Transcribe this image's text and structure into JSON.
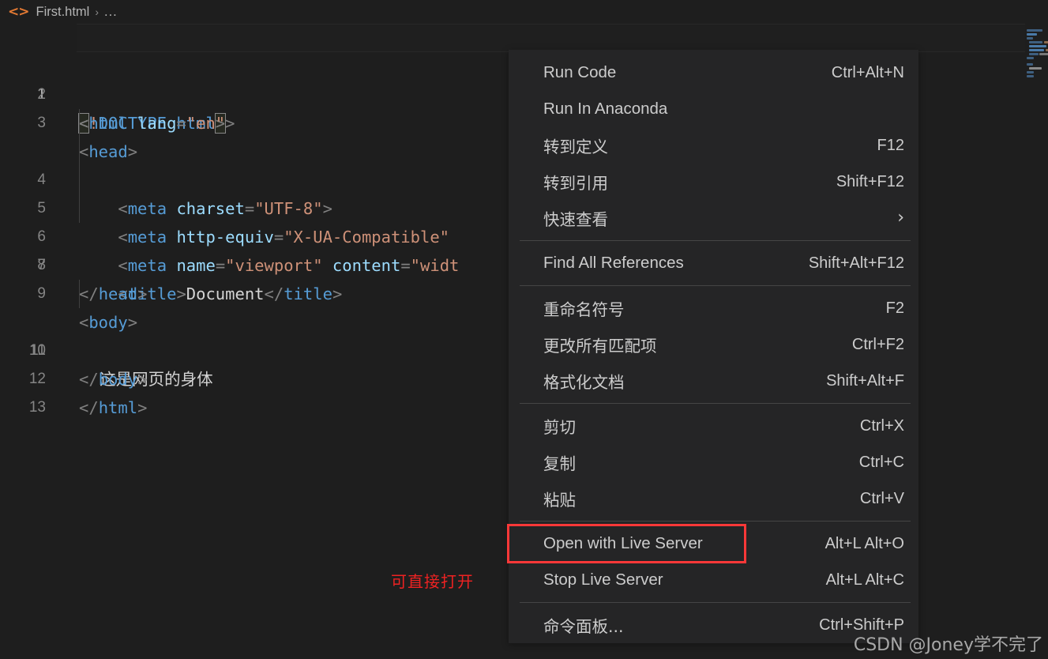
{
  "breadcrumb": {
    "icon": "html-file-icon",
    "file": "First.html",
    "separator": "›",
    "overflow": "..."
  },
  "editor": {
    "language": "html",
    "active_line": 1,
    "lines": [
      {
        "number": "1",
        "text": "<!DOCTYPE html>"
      },
      {
        "number": "2",
        "text": "<html lang=\"en\">"
      },
      {
        "number": "3",
        "text": "<head>"
      },
      {
        "number": "4",
        "text": "    <meta charset=\"UTF-8\">"
      },
      {
        "number": "5",
        "text": "    <meta http-equiv=\"X-UA-Compatible\""
      },
      {
        "number": "6",
        "text": "    <meta name=\"viewport\" content=\"widt"
      },
      {
        "number": "7",
        "text": "    <title>Document</title>"
      },
      {
        "number": "8",
        "text": "</head>"
      },
      {
        "number": "9",
        "text": "<body>"
      },
      {
        "number": "10",
        "text": "    这是网页的身体"
      },
      {
        "number": "11",
        "text": "</body>"
      },
      {
        "number": "12",
        "text": "</html>"
      },
      {
        "number": "13",
        "text": ""
      }
    ]
  },
  "annotation": {
    "text": "可直接打开",
    "color": "#ee2222"
  },
  "context_menu": {
    "groups": [
      {
        "items": [
          {
            "label": "Run Code",
            "key": "Ctrl+Alt+N",
            "cjk": false,
            "submenu": false,
            "highlighted": false
          },
          {
            "label": "Run In Anaconda",
            "key": "",
            "cjk": false,
            "submenu": false,
            "highlighted": false
          },
          {
            "label": "转到定义",
            "key": "F12",
            "cjk": true,
            "submenu": false,
            "highlighted": false
          },
          {
            "label": "转到引用",
            "key": "Shift+F12",
            "cjk": true,
            "submenu": false,
            "highlighted": false
          },
          {
            "label": "快速查看",
            "key": "",
            "cjk": true,
            "submenu": true,
            "highlighted": false
          }
        ]
      },
      {
        "items": [
          {
            "label": "Find All References",
            "key": "Shift+Alt+F12",
            "cjk": false,
            "submenu": false,
            "highlighted": false
          }
        ]
      },
      {
        "items": [
          {
            "label": "重命名符号",
            "key": "F2",
            "cjk": true,
            "submenu": false,
            "highlighted": false
          },
          {
            "label": "更改所有匹配项",
            "key": "Ctrl+F2",
            "cjk": true,
            "submenu": false,
            "highlighted": false
          },
          {
            "label": "格式化文档",
            "key": "Shift+Alt+F",
            "cjk": true,
            "submenu": false,
            "highlighted": false
          }
        ]
      },
      {
        "items": [
          {
            "label": "剪切",
            "key": "Ctrl+X",
            "cjk": true,
            "submenu": false,
            "highlighted": false
          },
          {
            "label": "复制",
            "key": "Ctrl+C",
            "cjk": true,
            "submenu": false,
            "highlighted": false
          },
          {
            "label": "粘贴",
            "key": "Ctrl+V",
            "cjk": true,
            "submenu": false,
            "highlighted": false
          }
        ]
      },
      {
        "items": [
          {
            "label": "Open with Live Server",
            "key": "Alt+L Alt+O",
            "cjk": false,
            "submenu": false,
            "highlighted": true
          },
          {
            "label": "Stop Live Server",
            "key": "Alt+L Alt+C",
            "cjk": false,
            "submenu": false,
            "highlighted": false
          }
        ]
      },
      {
        "items": [
          {
            "label": "命令面板...",
            "key": "Ctrl+Shift+P",
            "cjk": true,
            "submenu": false,
            "highlighted": false
          }
        ]
      }
    ]
  },
  "watermark": {
    "text": "CSDN @Joney学不完了"
  },
  "colors": {
    "editor_background": "#1e1e1e",
    "menu_background": "#252526",
    "menu_separator": "#454545",
    "menu_text": "#cccccc",
    "accent_red": "#fc3838",
    "tag": "#569cd6",
    "attribute": "#9cdcfe",
    "string": "#ce9178",
    "punctuation": "#808080",
    "line_number": "#858585",
    "breadcrumb_icon": "#e37933"
  }
}
